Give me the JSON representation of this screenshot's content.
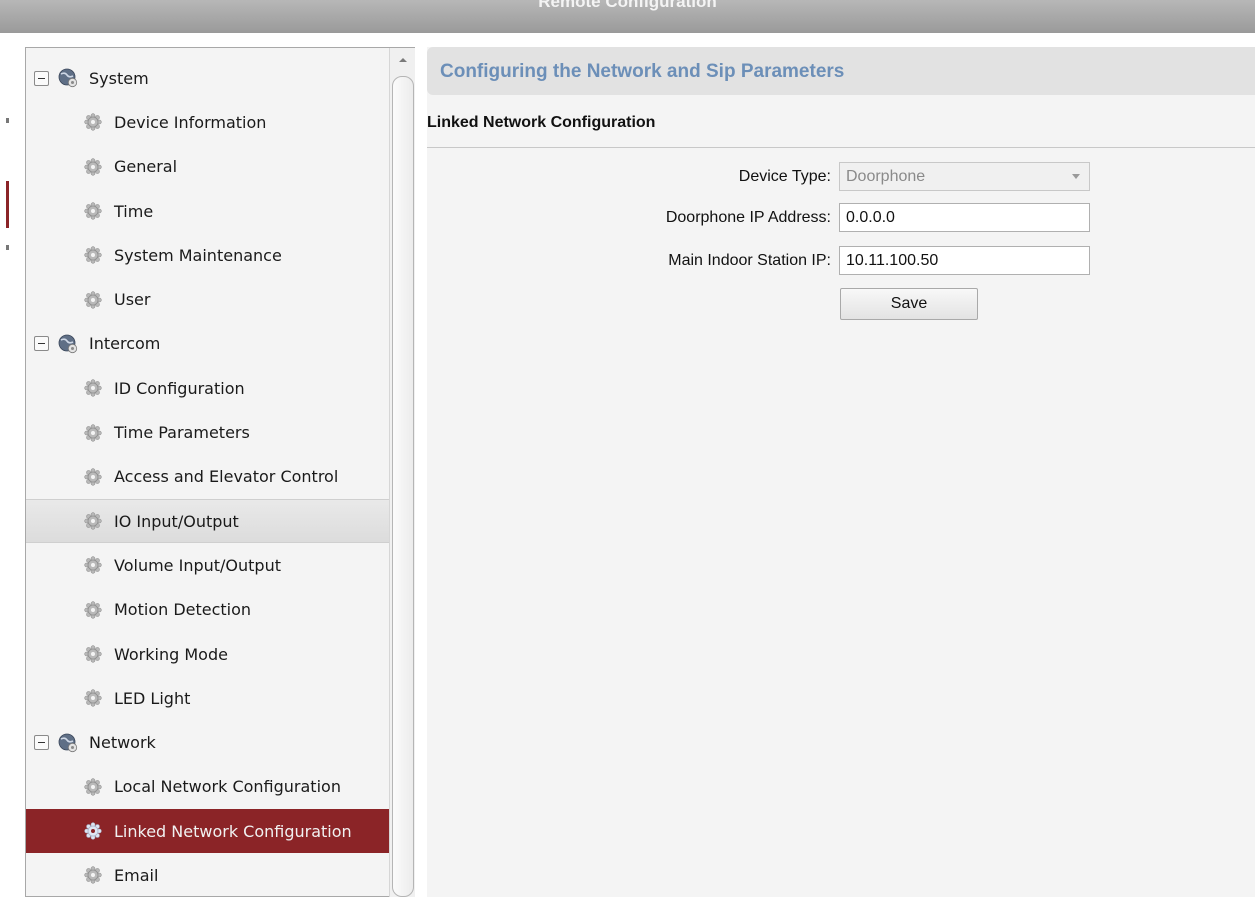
{
  "window": {
    "title": "Remote Configuration"
  },
  "colors": {
    "selected_bg": "#8b2427",
    "header_text": "#6c8fb8",
    "titlebar": "#a9a9a9"
  },
  "tree": [
    {
      "type": "group",
      "label": "System",
      "icon": "globe-gear-icon"
    },
    {
      "type": "leaf",
      "label": "Device Information",
      "icon": "gear-icon"
    },
    {
      "type": "leaf",
      "label": "General",
      "icon": "gear-icon"
    },
    {
      "type": "leaf",
      "label": "Time",
      "icon": "gear-icon"
    },
    {
      "type": "leaf",
      "label": "System Maintenance",
      "icon": "gear-icon"
    },
    {
      "type": "leaf",
      "label": "User",
      "icon": "gear-icon"
    },
    {
      "type": "group",
      "label": "Intercom",
      "icon": "globe-gear-icon"
    },
    {
      "type": "leaf",
      "label": "ID Configuration",
      "icon": "gear-icon"
    },
    {
      "type": "leaf",
      "label": "Time Parameters",
      "icon": "gear-icon"
    },
    {
      "type": "leaf",
      "label": "Access and Elevator Control",
      "icon": "gear-icon"
    },
    {
      "type": "leaf",
      "label": "IO Input/Output",
      "icon": "gear-icon",
      "state": "hover"
    },
    {
      "type": "leaf",
      "label": "Volume Input/Output",
      "icon": "gear-icon"
    },
    {
      "type": "leaf",
      "label": "Motion Detection",
      "icon": "gear-icon"
    },
    {
      "type": "leaf",
      "label": "Working Mode",
      "icon": "gear-icon"
    },
    {
      "type": "leaf",
      "label": "LED Light",
      "icon": "gear-icon"
    },
    {
      "type": "group",
      "label": "Network",
      "icon": "globe-gear-icon"
    },
    {
      "type": "leaf",
      "label": "Local Network Configuration",
      "icon": "gear-icon"
    },
    {
      "type": "leaf",
      "label": "Linked Network Configuration",
      "icon": "gear-icon",
      "state": "selected"
    },
    {
      "type": "leaf",
      "label": "Email",
      "icon": "gear-icon"
    }
  ],
  "content": {
    "header": "Configuring the Network and Sip Parameters",
    "section": "Linked Network Configuration",
    "fields": {
      "device_type": {
        "label": "Device Type:",
        "value": "Doorphone"
      },
      "doorphone_ip": {
        "label": "Doorphone IP Address:",
        "value": "0.0.0.0"
      },
      "main_indoor_ip": {
        "label": "Main Indoor Station IP:",
        "value": "10.11.100.50"
      }
    },
    "save_label": "Save"
  }
}
